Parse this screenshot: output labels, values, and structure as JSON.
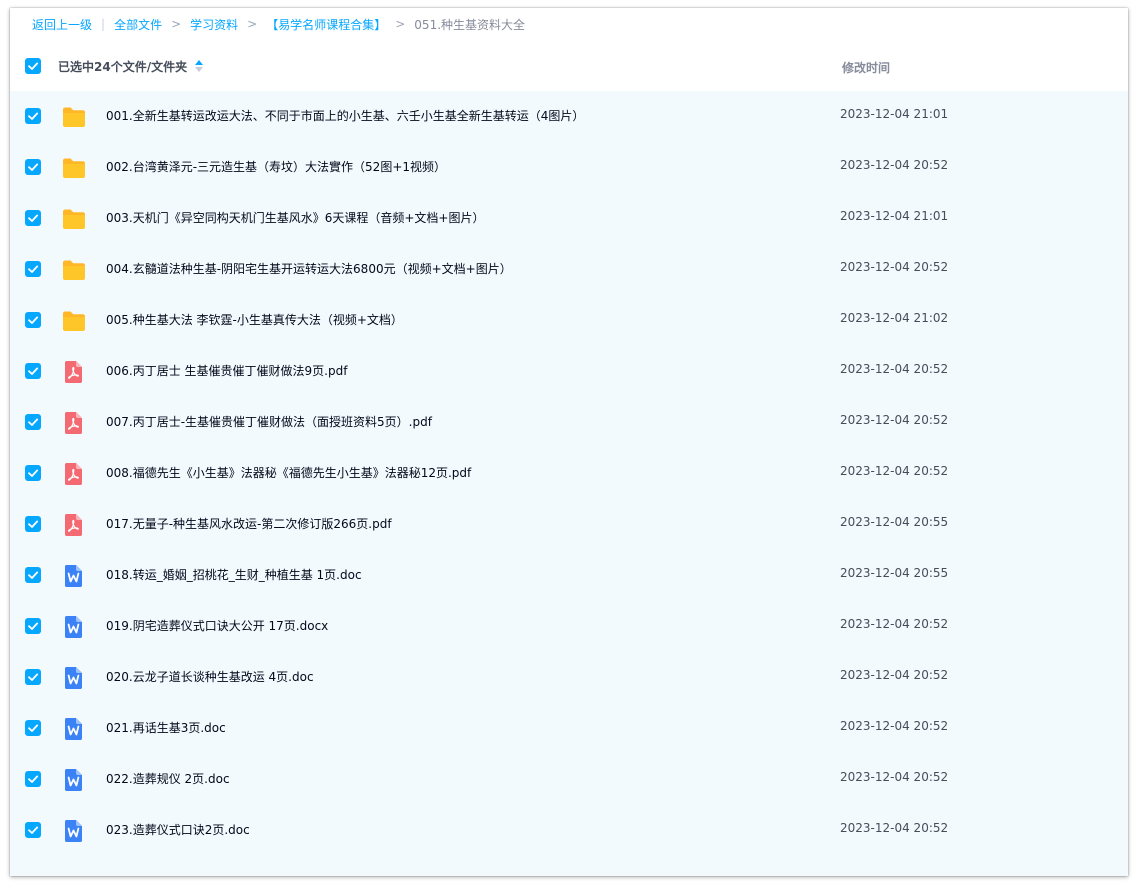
{
  "breadcrumb": {
    "back": "返回上一级",
    "items": [
      "全部文件",
      "学习资料",
      "【易学名师课程合集】"
    ],
    "current": "051.种生基资料大全"
  },
  "header": {
    "selected_label": "已选中24个文件/文件夹",
    "time_label": "修改时间"
  },
  "colors": {
    "accent": "#06a7ff",
    "folder": "#ffc629",
    "pdf": "#f46a72",
    "doc": "#3b82f6",
    "list_bg": "#f2fafd"
  },
  "files": [
    {
      "name": "001.全新生基转运改运大法、不同于市面上的小生基、六壬小生基全新生基转运（4图片）",
      "time": "2023-12-04 21:01",
      "type": "folder",
      "icon": "folder-icon"
    },
    {
      "name": "002.台湾黄泽元-三元造生基（寿坟）大法實作（52图+1视频）",
      "time": "2023-12-04 20:52",
      "type": "folder",
      "icon": "folder-icon"
    },
    {
      "name": "003.天机门《异空同构天机门生基风水》6天课程（音频+文档+图片）",
      "time": "2023-12-04 21:01",
      "type": "folder",
      "icon": "folder-icon"
    },
    {
      "name": "004.玄髓道法种生基-阴阳宅生基开运转运大法6800元（视频+文档+图片）",
      "time": "2023-12-04 20:52",
      "type": "folder",
      "icon": "folder-icon"
    },
    {
      "name": "005.种生基大法 李钦霆-小生基真传大法（视频+文档）",
      "time": "2023-12-04 21:02",
      "type": "folder",
      "icon": "folder-icon"
    },
    {
      "name": "006.丙丁居士 生基催贵催丁催财做法9页.pdf",
      "time": "2023-12-04 20:52",
      "type": "pdf",
      "icon": "pdf-icon"
    },
    {
      "name": "007.丙丁居士-生基催贵催丁催财做法（面授班资料5页）.pdf",
      "time": "2023-12-04 20:52",
      "type": "pdf",
      "icon": "pdf-icon"
    },
    {
      "name": "008.福德先生《小生基》法器秘《福德先生小生基》法器秘12页.pdf",
      "time": "2023-12-04 20:52",
      "type": "pdf",
      "icon": "pdf-icon"
    },
    {
      "name": "017.无量子-种生基风水改运-第二次修订版266页.pdf",
      "time": "2023-12-04 20:55",
      "type": "pdf",
      "icon": "pdf-icon"
    },
    {
      "name": "018.转运_婚姻_招桃花_生财_种植生基 1页.doc",
      "time": "2023-12-04 20:55",
      "type": "doc",
      "icon": "doc-icon"
    },
    {
      "name": "019.阴宅造葬仪式口诀大公开 17页.docx",
      "time": "2023-12-04 20:52",
      "type": "doc",
      "icon": "doc-icon"
    },
    {
      "name": "020.云龙子道长谈种生基改运 4页.doc",
      "time": "2023-12-04 20:52",
      "type": "doc",
      "icon": "doc-icon"
    },
    {
      "name": "021.再话生基3页.doc",
      "time": "2023-12-04 20:52",
      "type": "doc",
      "icon": "doc-icon"
    },
    {
      "name": "022.造葬规仪 2页.doc",
      "time": "2023-12-04 20:52",
      "type": "doc",
      "icon": "doc-icon"
    },
    {
      "name": "023.造葬仪式口诀2页.doc",
      "time": "2023-12-04 20:52",
      "type": "doc",
      "icon": "doc-icon"
    }
  ]
}
